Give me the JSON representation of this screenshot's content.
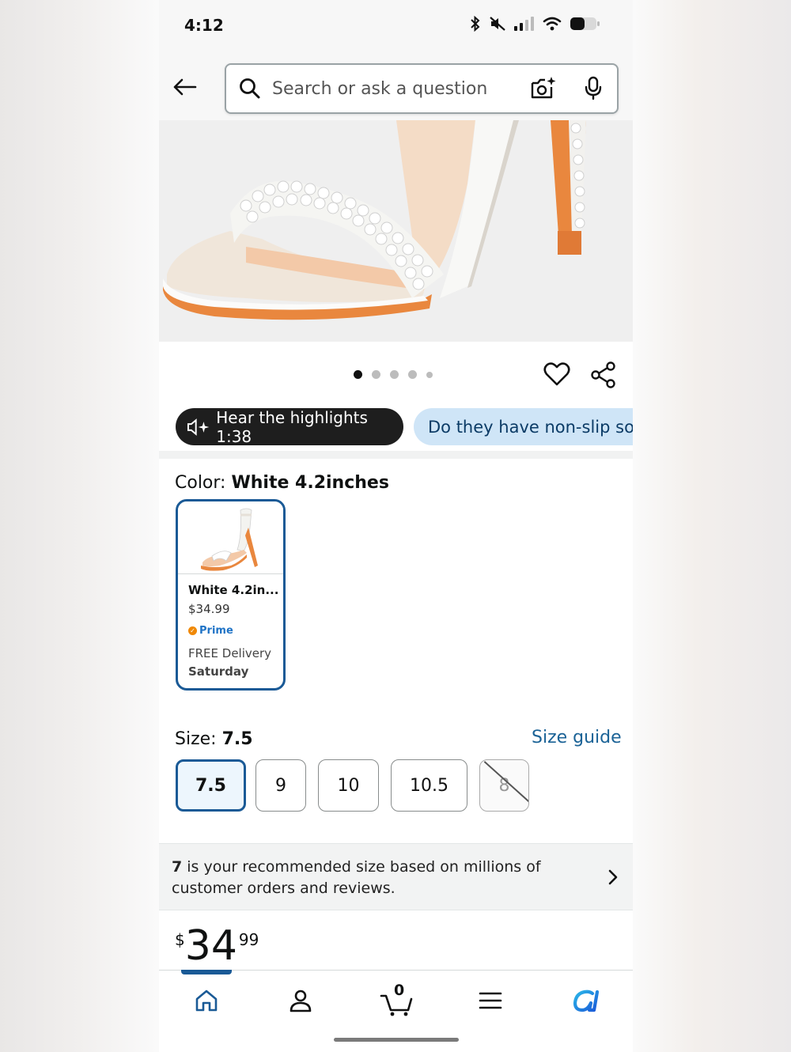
{
  "status_bar": {
    "time": "4:12"
  },
  "search": {
    "placeholder": "Search or ask a question"
  },
  "gallery": {
    "dot_count": 5,
    "active_index": 0
  },
  "pills": {
    "hear_label": "Hear the highlights 1:38",
    "question_label": "Do they have non-slip sole"
  },
  "color": {
    "label": "Color: ",
    "value": "White 4.2inches",
    "card": {
      "name": "White 4.2in...",
      "price": "$34.99",
      "prime": "Prime",
      "delivery": "FREE Delivery",
      "delivery_day": "Saturday"
    }
  },
  "size": {
    "label": "Size: ",
    "value": "7.5",
    "guide_label": "Size guide",
    "options": [
      "7.5",
      "9",
      "10",
      "10.5",
      "8"
    ],
    "selected": "7.5",
    "unavailable": [
      "8"
    ]
  },
  "recommendation": {
    "size": "7",
    "text": " is your recommended size based on millions of customer orders and reviews."
  },
  "price": {
    "symbol": "$",
    "whole": "34",
    "fraction": "99"
  },
  "cart": {
    "count": "0"
  },
  "colors": {
    "accent": "#1a5a96",
    "link": "#1a6296",
    "prime": "#1f73c6",
    "pill_dark": "#1e1e1e",
    "pill_light": "#cfe5f7"
  }
}
